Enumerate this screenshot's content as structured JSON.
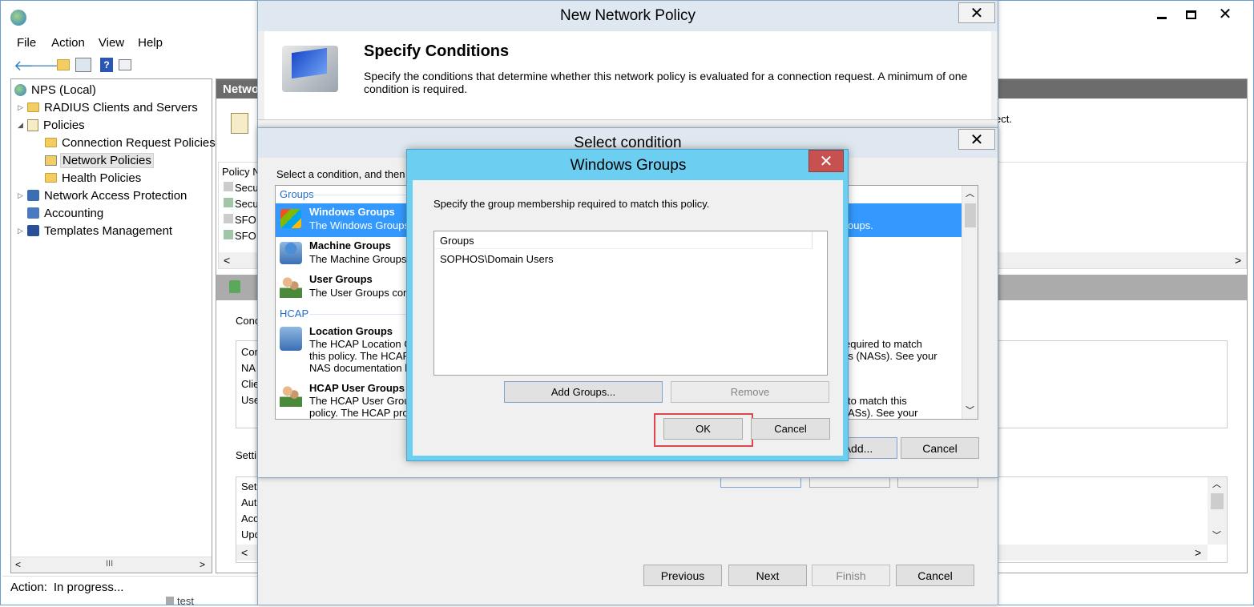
{
  "mmc": {
    "menu": [
      "File",
      "Action",
      "View",
      "Help"
    ],
    "tree": [
      {
        "label": "NPS (Local)",
        "level": 0
      },
      {
        "label": "RADIUS Clients and Servers",
        "level": 1
      },
      {
        "label": "Policies",
        "level": 1
      },
      {
        "label": "Connection Request Policies",
        "level": 2
      },
      {
        "label": "Network Policies",
        "level": 2
      },
      {
        "label": "Health Policies",
        "level": 2
      },
      {
        "label": "Network Access Protection",
        "level": 1
      },
      {
        "label": "Accounting",
        "level": 1
      },
      {
        "label": "Templates Management",
        "level": 1
      }
    ],
    "status_label": "Action:",
    "status_text": "In progress...",
    "panel_header": "Netwo",
    "panel_text_frag": "ect.",
    "list_header": "Policy N",
    "list_rows": [
      "Secu",
      "Secu",
      "SFO",
      "SFO"
    ],
    "section_cond": "Conc",
    "cond_rows": [
      "Cor",
      "NA",
      "Clie",
      "Use"
    ],
    "section_settings": "Setti",
    "settings_rows": [
      "Set",
      "Auth",
      "Acc",
      "Upd"
    ],
    "bottom_item": "test"
  },
  "new_policy": {
    "title": "New Network Policy",
    "heading": "Specify Conditions",
    "description": "Specify the conditions that determine whether this network policy is evaluated for a connection request. A minimum of one condition is required.",
    "buttons": {
      "previous": "Previous",
      "next": "Next",
      "finish": "Finish",
      "cancel": "Cancel"
    }
  },
  "select_condition": {
    "title": "Select condition",
    "intro": "Select a condition, and then",
    "groups_header": "Groups",
    "hcap_header": "HCAP",
    "items": [
      {
        "name": "Windows Groups",
        "desc": "The Windows Groups",
        "desc_right": "oups."
      },
      {
        "name": "Machine Groups",
        "desc": "The Machine Groups"
      },
      {
        "name": "User Groups",
        "desc": "The User Groups con"
      },
      {
        "name": "Location Groups",
        "desc": "The HCAP Location G",
        "desc2": "this policy. The HCAP",
        "desc3": "NAS documentation b",
        "right1": "equired to match",
        "right2": "rs (NASs). See your"
      },
      {
        "name": "HCAP User Groups",
        "desc": "The HCAP User Group",
        "desc2": "policy. The HCAP pro",
        "right1": "to match this",
        "right2": "ASs). See your"
      }
    ],
    "buttons": {
      "add": "Add...",
      "cancel": "Cancel"
    }
  },
  "windows_groups": {
    "title": "Windows Groups",
    "instruction": "Specify the group membership required to match this policy.",
    "column": "Groups",
    "rows": [
      "SOPHOS\\Domain Users"
    ],
    "buttons": {
      "add_groups": "Add Groups...",
      "remove": "Remove",
      "ok": "OK",
      "cancel": "Cancel"
    }
  },
  "colors": {
    "accent": "#6ccff1",
    "highlight": "#3399ff",
    "ok_outline": "#e0474c",
    "close_red": "#c75050"
  }
}
